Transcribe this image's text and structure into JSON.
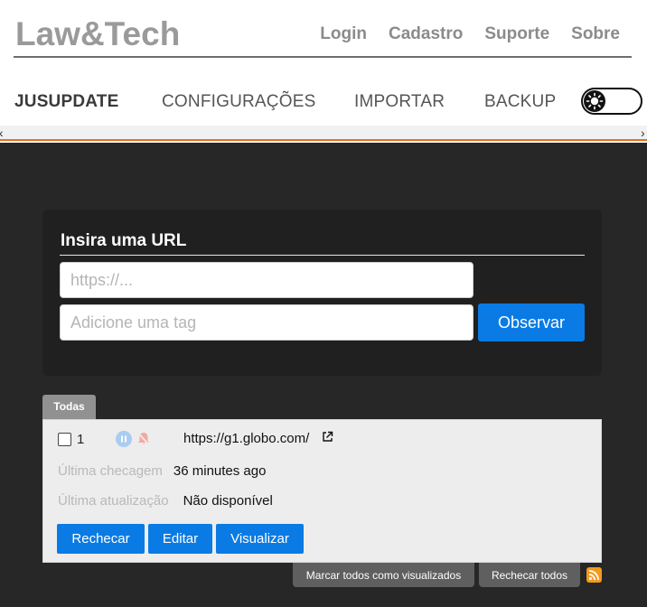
{
  "header": {
    "brand": "Law&Tech",
    "links": [
      "Login",
      "Cadastro",
      "Suporte",
      "Sobre"
    ]
  },
  "nav": {
    "items": [
      "JUSUPDATE",
      "CONFIGURAÇÕES",
      "IMPORTAR",
      "BACKUP"
    ],
    "active": "JUSUPDATE"
  },
  "colors": {
    "accent": "#0a7be4",
    "orange_line": "#e46f25",
    "dark_bg": "#272727"
  },
  "url_form": {
    "title": "Insira uma URL",
    "url_placeholder": "https://...",
    "tag_placeholder": "Adicione uma tag",
    "submit_label": "Observar"
  },
  "tabs": [
    "Todas"
  ],
  "items": [
    {
      "index": "1",
      "url": "https://g1.globo.com/",
      "last_check_label": "Última checagem",
      "last_check_value": "36 minutes ago",
      "last_update_label": "Última atualização",
      "last_update_value": "Não disponível",
      "buttons": [
        "Rechecar",
        "Editar",
        "Visualizar"
      ]
    }
  ],
  "footer_actions": {
    "mark_all": "Marcar todos como visualizados",
    "recheck_all": "Rechecar todos"
  }
}
